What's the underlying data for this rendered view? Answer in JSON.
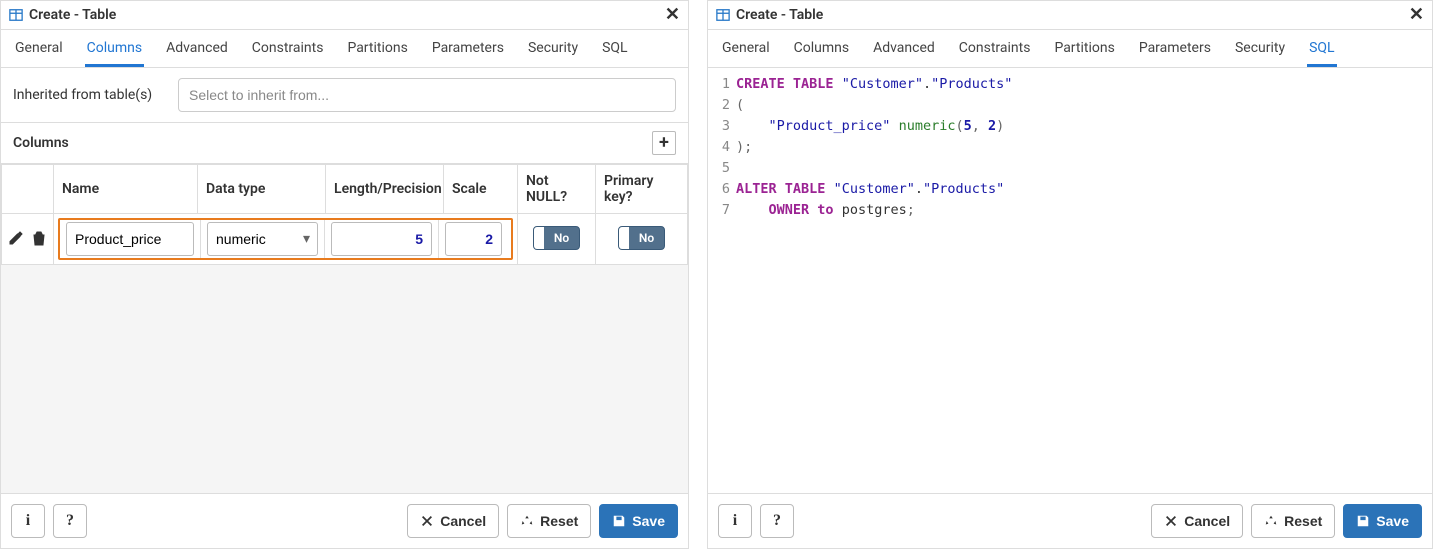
{
  "common": {
    "window_title": "Create - Table",
    "tabs": [
      "General",
      "Columns",
      "Advanced",
      "Constraints",
      "Partitions",
      "Parameters",
      "Security",
      "SQL"
    ],
    "footer": {
      "info_label": "i",
      "help_label": "?",
      "cancel": "Cancel",
      "reset": "Reset",
      "save": "Save"
    }
  },
  "left": {
    "active_tab": "Columns",
    "inherit_label": "Inherited from table(s)",
    "inherit_placeholder": "Select to inherit from...",
    "section_title": "Columns",
    "headers": {
      "name": "Name",
      "datatype": "Data type",
      "length": "Length/Precision",
      "scale": "Scale",
      "notnull": "Not NULL?",
      "pkey": "Primary key?"
    },
    "row": {
      "name": "Product_price",
      "datatype": "numeric",
      "length": "5",
      "scale": "2",
      "notnull_label": "No",
      "pkey_label": "No"
    }
  },
  "right": {
    "active_tab": "SQL",
    "sql": {
      "l1": {
        "kw1": "CREATE ",
        "kw2": "TABLE ",
        "s1": "\"Customer\"",
        "dot": ".",
        "s2": "\"Products\""
      },
      "l2": "(",
      "l3": {
        "pad": "    ",
        "col": "\"Product_price\"",
        "sp": " ",
        "fn": "numeric",
        "open": "(",
        "a": "5",
        "comma": ", ",
        "b": "2",
        "close": ")"
      },
      "l4": ");",
      "l5": "",
      "l6": {
        "kw1": "ALTER ",
        "kw2": "TABLE ",
        "s1": "\"Customer\"",
        "dot": ".",
        "s2": "\"Products\""
      },
      "l7": {
        "pad": "    ",
        "kw1": "OWNER ",
        "kw2": "to ",
        "id": "postgres",
        "semi": ";"
      }
    }
  }
}
